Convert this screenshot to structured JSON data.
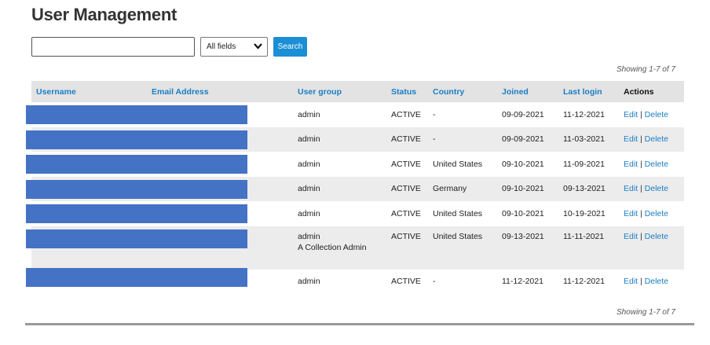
{
  "page": {
    "title": "User Management"
  },
  "search": {
    "value": "",
    "placeholder": "",
    "field_selected": "All fields",
    "button_label": "Search"
  },
  "pagination": {
    "top_text": "Showing 1-7 of 7",
    "bottom_text": "Showing 1-7 of 7"
  },
  "table": {
    "headers": {
      "username": "Username",
      "email": "Email Address",
      "group": "User group",
      "status": "Status",
      "country": "Country",
      "joined": "Joined",
      "last_login": "Last login",
      "actions": "Actions"
    },
    "action_labels": {
      "edit": "Edit",
      "separator": "|",
      "delete": "Delete"
    },
    "rows": [
      {
        "group": "admin",
        "group2": "",
        "status": "ACTIVE",
        "country": "-",
        "joined": "09-09-2021",
        "last_login": "11-12-2021"
      },
      {
        "group": "admin",
        "group2": "",
        "status": "ACTIVE",
        "country": "-",
        "joined": "09-09-2021",
        "last_login": "11-03-2021"
      },
      {
        "group": "admin",
        "group2": "",
        "status": "ACTIVE",
        "country": "United States",
        "joined": "09-10-2021",
        "last_login": "11-09-2021"
      },
      {
        "group": "admin",
        "group2": "",
        "status": "ACTIVE",
        "country": "Germany",
        "joined": "09-10-2021",
        "last_login": "09-13-2021"
      },
      {
        "group": "admin",
        "group2": "",
        "status": "ACTIVE",
        "country": "United States",
        "joined": "09-10-2021",
        "last_login": "10-19-2021"
      },
      {
        "group": "admin",
        "group2": "A Collection Admin",
        "status": "ACTIVE",
        "country": "United States",
        "joined": "09-13-2021",
        "last_login": "11-11-2021"
      },
      {
        "group": "admin",
        "group2": "",
        "status": "ACTIVE",
        "country": "-",
        "joined": "11-12-2021",
        "last_login": "11-12-2021"
      }
    ]
  },
  "colors": {
    "accent": "#1a8fd6",
    "link": "#1a7ec5",
    "header_bg": "#e3e3e3",
    "redaction": "#4472c4"
  },
  "icons": {
    "select_chevron": "chevron-down-icon"
  }
}
